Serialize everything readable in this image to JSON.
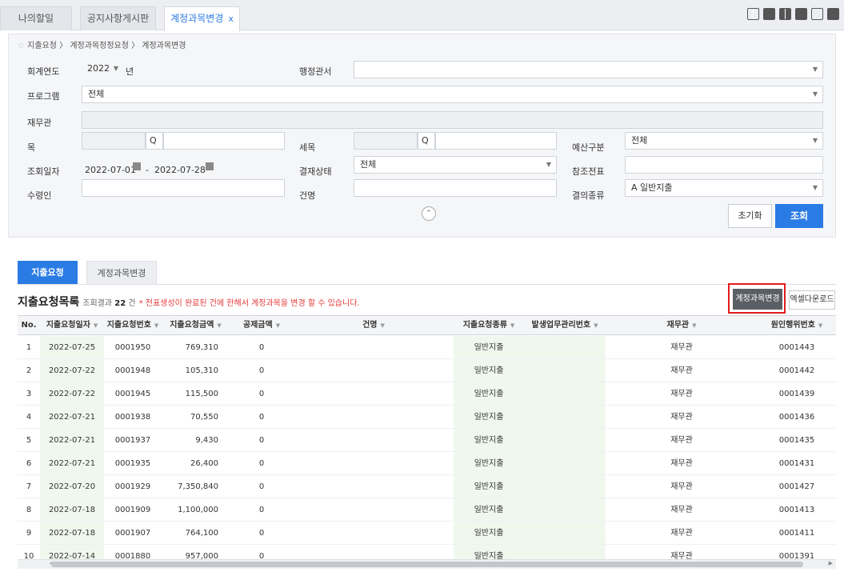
{
  "tabs": [
    {
      "label": "나의할일"
    },
    {
      "label": "공지사항게시판"
    },
    {
      "label": "계정과목변경",
      "close": "x"
    }
  ],
  "breadcrumb": "지출요청 〉 계정과목정정요청 〉 계정과목변경",
  "form": {
    "fiscal_year_label": "회계연도",
    "fiscal_year_value": "2022",
    "fiscal_year_unit": "년",
    "admin_office_label": "행정관서",
    "admin_office_value": "",
    "program_label": "프로그램",
    "program_value": "전체",
    "finance_officer_label": "재무관",
    "item_label": "목",
    "subitem_label": "세목",
    "budget_type_label": "예산구분",
    "budget_type_value": "전체",
    "date_label": "조회일자",
    "date_from": "2022-07-01",
    "date_sep": "-",
    "date_to": "2022-07-28",
    "approval_status_label": "결재상태",
    "approval_status_value": "전체",
    "ref_voucher_label": "참조전표",
    "payee_label": "수령인",
    "subject_label": "건명",
    "decision_type_label": "결의종류",
    "decision_type_value": "A 일반지출",
    "reset_label": "초기화",
    "search_label": "조회"
  },
  "list_tabs": [
    {
      "label": "지출요청"
    },
    {
      "label": "계정과목변경"
    }
  ],
  "list": {
    "title": "지출요청목록",
    "result_prefix": "조회결과",
    "result_count": "22",
    "result_suffix": "건",
    "note": "* 전표생성이 완료된 건에 한해서 계정과목을 변경 할 수 있습니다.",
    "change_button": "계정과목변경",
    "excel_button": "엑셀다운로드"
  },
  "columns": [
    "No.",
    "지출요청일자",
    "지출요청번호",
    "지출요청금액",
    "공제금액",
    "건명",
    "지출요청종류",
    "발생업무관리번호",
    "재무관",
    "원인행위번호"
  ],
  "rows": [
    [
      "1",
      "2022-07-25",
      "0001950",
      "769,310",
      "0",
      "",
      "일반지출",
      "",
      "재무관",
      "0001443"
    ],
    [
      "2",
      "2022-07-22",
      "0001948",
      "105,310",
      "0",
      "",
      "일반지출",
      "",
      "재무관",
      "0001442"
    ],
    [
      "3",
      "2022-07-22",
      "0001945",
      "115,500",
      "0",
      "",
      "일반지출",
      "",
      "재무관",
      "0001439"
    ],
    [
      "4",
      "2022-07-21",
      "0001938",
      "70,550",
      "0",
      "",
      "일반지출",
      "",
      "재무관",
      "0001436"
    ],
    [
      "5",
      "2022-07-21",
      "0001937",
      "9,430",
      "0",
      "",
      "일반지출",
      "",
      "재무관",
      "0001435"
    ],
    [
      "6",
      "2022-07-21",
      "0001935",
      "26,400",
      "0",
      "",
      "일반지출",
      "",
      "재무관",
      "0001431"
    ],
    [
      "7",
      "2022-07-20",
      "0001929",
      "7,350,840",
      "0",
      "",
      "일반지출",
      "",
      "재무관",
      "0001427"
    ],
    [
      "8",
      "2022-07-18",
      "0001909",
      "1,100,000",
      "0",
      "",
      "일반지출",
      "",
      "재무관",
      "0001413"
    ],
    [
      "9",
      "2022-07-18",
      "0001907",
      "764,100",
      "0",
      "",
      "일반지출",
      "",
      "재무관",
      "0001411"
    ],
    [
      "10",
      "2022-07-14",
      "0001880",
      "957,000",
      "0",
      "",
      "일반지출",
      "",
      "재무관",
      "0001391"
    ]
  ]
}
